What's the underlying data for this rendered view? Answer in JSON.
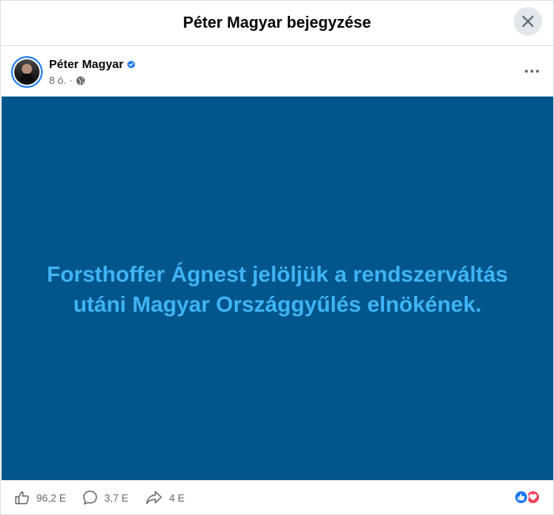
{
  "dialog": {
    "title": "Péter Magyar bejegyzése"
  },
  "author": {
    "name": "Péter Magyar",
    "time": "8 ó."
  },
  "post": {
    "background_color": "#02568b",
    "text_color": "#3fb4f4",
    "line1": "Forsthoffer Ágnest jelöljük a rendszerváltás",
    "line2": "utáni Magyar Országgyűlés elnökének."
  },
  "footer": {
    "likes": "96,2 E",
    "comments": "3,7 E",
    "shares": "4 E"
  },
  "colors": {
    "accent": "#1877f2",
    "love": "#f33e58"
  },
  "icons": [
    "close-icon",
    "verified-badge-icon",
    "globe-icon",
    "more-options-icon",
    "like-icon",
    "comment-icon",
    "share-icon",
    "like-reaction-icon",
    "love-reaction-icon"
  ]
}
